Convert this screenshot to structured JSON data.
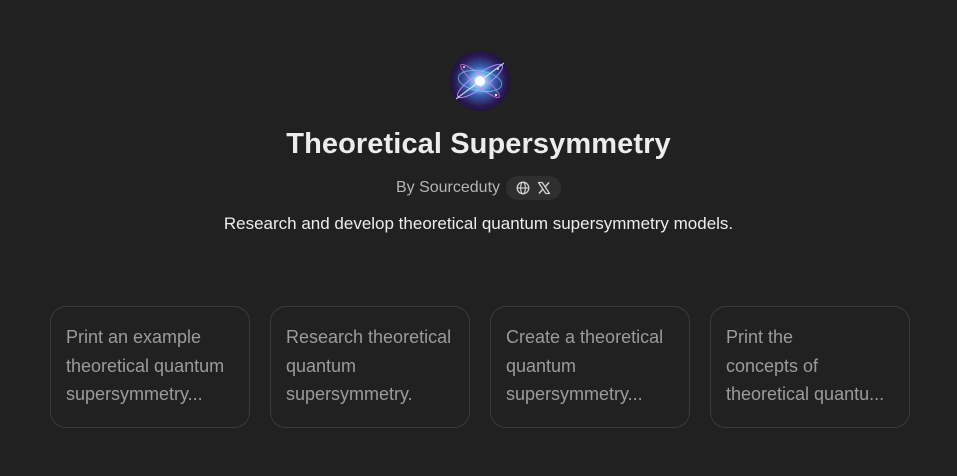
{
  "gpt": {
    "name": "Theoretical Supersymmetry",
    "author": "By Sourceduty",
    "description": "Research and develop theoretical quantum supersymmetry models.",
    "link_icons": [
      "globe-icon",
      "x-logo-icon"
    ]
  },
  "conversation_starters": [
    {
      "lines": [
        "Print an example",
        "theoretical quantum",
        "supersymmetry..."
      ]
    },
    {
      "lines": [
        "Research theoretical",
        "quantum",
        "supersymmetry."
      ]
    },
    {
      "lines": [
        "Create a theoretical",
        "quantum",
        "supersymmetry..."
      ]
    },
    {
      "lines": [
        "Print the",
        "concepts of",
        "theoretical quantu..."
      ]
    }
  ],
  "colors": {
    "background": "#212121",
    "title": "#ececec",
    "muted": "#b4b4b4",
    "starter_text": "#9b9b9b",
    "starter_border": "#3a3a3a"
  }
}
